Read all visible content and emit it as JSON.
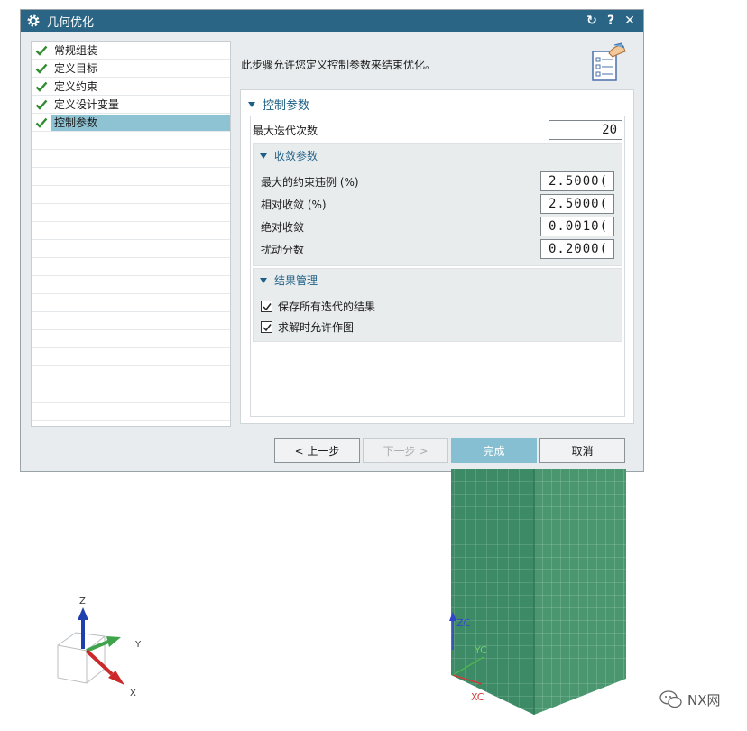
{
  "dialog": {
    "title": "几何优化",
    "reset_icon": "↻",
    "help_icon": "?",
    "close_icon": "✕"
  },
  "steps": [
    {
      "label": "常规组装",
      "done": true,
      "selected": false
    },
    {
      "label": "定义目标",
      "done": true,
      "selected": false
    },
    {
      "label": "定义约束",
      "done": true,
      "selected": false
    },
    {
      "label": "定义设计变量",
      "done": true,
      "selected": false
    },
    {
      "label": "控制参数",
      "done": true,
      "selected": true
    }
  ],
  "description": "此步骤允许您定义控制参数来结束优化。",
  "control": {
    "section_title": "控制参数",
    "max_iter_label": "最大迭代次数",
    "max_iter_value": "20"
  },
  "convergence": {
    "title": "收敛参数",
    "rows": [
      {
        "label": "最大的约束违例 (%)",
        "value": "2.5000("
      },
      {
        "label": "相对收敛 (%)",
        "value": "2.5000("
      },
      {
        "label": "绝对收敛",
        "value": "0.0010("
      },
      {
        "label": "扰动分数",
        "value": "0.2000("
      }
    ]
  },
  "results": {
    "title": "结果管理",
    "options": [
      {
        "label": "保存所有迭代的结果",
        "checked": true
      },
      {
        "label": "求解时允许作图",
        "checked": true
      }
    ]
  },
  "buttons": {
    "back": "< 上一步",
    "next": "下一步 >",
    "finish": "完成",
    "cancel": "取消"
  },
  "triad": {
    "z": "Z",
    "y": "Y",
    "x": "X"
  },
  "model_axes": {
    "zc": "ZC",
    "yc": "YC",
    "xc": "XC"
  },
  "watermark": "NX网",
  "colors": {
    "titlebar": "#2a6585",
    "selection": "#8ec3d4",
    "primary_button": "#87bfd2",
    "section_text": "#1d5f86",
    "check_green": "#2e8b2e",
    "mesh_fill": "#3d8a66"
  }
}
